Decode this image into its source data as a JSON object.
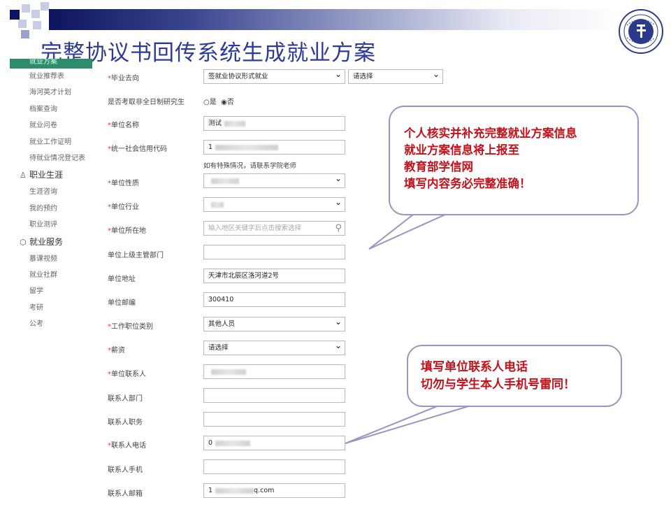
{
  "slide_title": "完整协议书回传系统生成就业方案",
  "sidebar": {
    "active_item": "就业方案",
    "items_a": [
      "就业推荐表",
      "海河英才计划",
      "档案查询",
      "就业问卷",
      "就业工作证明",
      "待就业情况登记表"
    ],
    "group_career": "职业生涯",
    "items_b": [
      "生涯咨询",
      "我的预约",
      "职业测评"
    ],
    "group_service": "就业服务",
    "items_c": [
      "慕课视频",
      "就业社群",
      "留学",
      "考研",
      "公考"
    ]
  },
  "form": {
    "destination": {
      "label": "毕业去向",
      "required": "*",
      "value": "签就业协议形式就业",
      "extra_select": "请选择"
    },
    "part_time_grad": {
      "label": "是否考取非全日制研究生",
      "opt_yes": "○是",
      "opt_no": "◉否"
    },
    "company_name": {
      "label": "单位名称",
      "required": "*",
      "value": "测试"
    },
    "credit_code": {
      "label": "统一社会信用代码",
      "required": "*",
      "value": "1",
      "hint": "如有特殊情况，请联系学院老师"
    },
    "company_nature": {
      "label": "单位性质",
      "required": "*",
      "value": ""
    },
    "industry": {
      "label": "单位行业",
      "required": "*",
      "value": ""
    },
    "location": {
      "label": "单位所在地",
      "required": "*",
      "placeholder": "输入地区关键字后点击搜索选择"
    },
    "superior_dept": {
      "label": "单位上级主管部门",
      "value": ""
    },
    "address": {
      "label": "单位地址",
      "value": "天津市北辰区洛河道2号"
    },
    "postcode": {
      "label": "单位邮编",
      "value": "300410"
    },
    "job_category": {
      "label": "工作职位类别",
      "required": "*",
      "value": "其他人员"
    },
    "salary": {
      "label": "薪资",
      "required": "*",
      "value": "请选择"
    },
    "contact_person": {
      "label": "单位联系人",
      "required": "*",
      "value": ""
    },
    "contact_dept": {
      "label": "联系人部门",
      "value": ""
    },
    "contact_title": {
      "label": "联系人职务",
      "value": ""
    },
    "contact_phone": {
      "label": "联系人电话",
      "required": "*",
      "value": "0"
    },
    "contact_mobile": {
      "label": "联系人手机",
      "value": ""
    },
    "contact_email": {
      "label": "联系人邮箱",
      "value": "1",
      "value_tail": "q.com"
    }
  },
  "callout_1": {
    "line1": "个人核实并补充完整就业方案信息",
    "line2": "就业方案信息将上报至",
    "line3": "教育部学信网",
    "line4": "填写内容务必完整准确！"
  },
  "callout_2": {
    "line1": "填写单位联系人电话",
    "line2": "切勿与学生本人手机号雷同！"
  },
  "colors": {
    "title": "#2c3a98",
    "callout_text": "#c4111b",
    "callout_border": "#9b93c6",
    "sidebar_active": "#2e8b6c",
    "required": "#e53935"
  },
  "icons": [
    "school-seal-logo",
    "search-icon",
    "chevron-down-icon",
    "career-icon",
    "service-icon"
  ]
}
